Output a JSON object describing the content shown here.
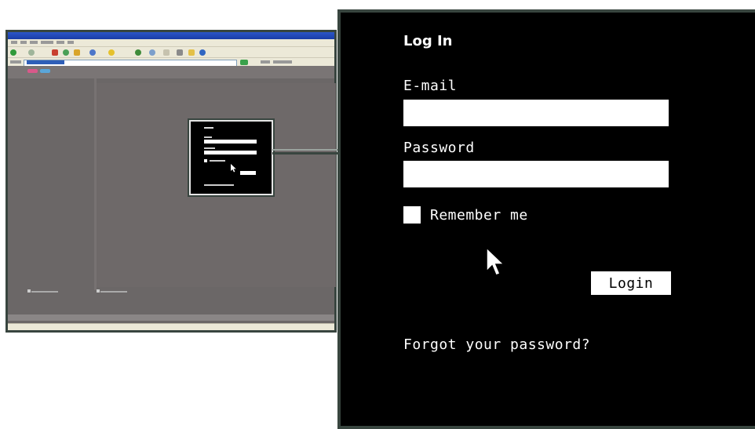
{
  "login": {
    "title": "Log In",
    "email_label": "E-mail",
    "email_value": "",
    "password_label": "Password",
    "password_value": "",
    "remember_label": "Remember me",
    "remember_checked": false,
    "login_button": "Login",
    "forgot_link": "Forgot your password?"
  },
  "colors": {
    "panel_bg": "#000000",
    "frame_border": "#38453f",
    "thumbnail_page_bg": "#6b6767",
    "titlebar_blue": "#2c56c8"
  },
  "icons": {
    "pointer": "arrow-cursor-icon"
  }
}
